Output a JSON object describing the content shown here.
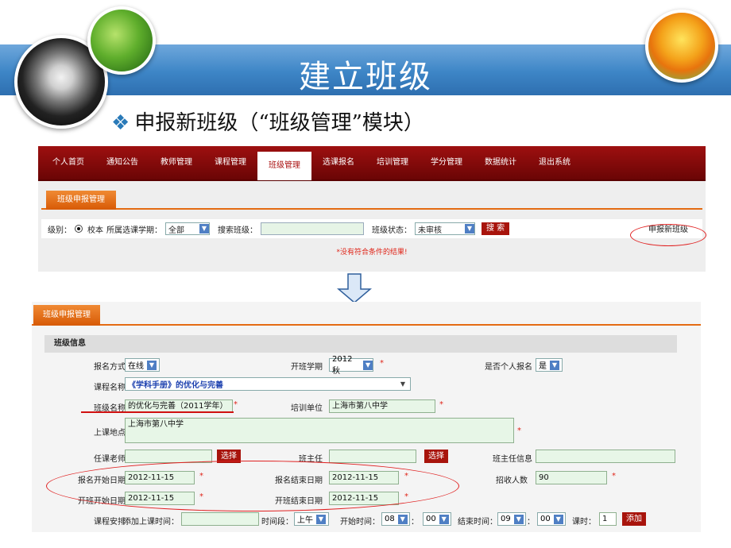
{
  "slide": {
    "title": "建立班级",
    "subtitle": "申报新班级（“班级管理”模块）"
  },
  "top_screen": {
    "nav": [
      "个人首页",
      "通知公告",
      "教师管理",
      "课程管理",
      "班级管理",
      "选课报名",
      "培训管理",
      "学分管理",
      "数据统计",
      "退出系统"
    ],
    "active_nav": "班级管理",
    "tab": "班级申报管理",
    "filter": {
      "level_label": "级别：",
      "level_option": "校本",
      "term_label": "所属选课学期：",
      "term_value": "全部",
      "search_label": "搜索班级：",
      "status_label": "班级状态：",
      "status_value": "未审核",
      "search_button": "搜 索",
      "apply_link": "申报新班级"
    },
    "no_result": "*没有符合条件的结果!"
  },
  "bottom_screen": {
    "tab": "班级申报管理",
    "section": "班级信息",
    "signup_mode_label": "报名方式",
    "signup_mode_value": "在线",
    "start_term_label": "开班学期",
    "start_term_value": "2012秋",
    "personal_signup_label": "是否个人报名",
    "personal_signup_value": "是",
    "course_label": "课程名称",
    "course_value": "《学科手册》的优化与完善",
    "class_name_label": "班级名称",
    "class_name_value": "的优化与完善（2011学年）",
    "training_unit_label": "培训单位",
    "training_unit_value": "上海市第八中学",
    "location_label": "上课地点",
    "location_value": "上海市第八中学",
    "teacher_label": "任课老师",
    "choose_button": "选择",
    "head_teacher_label": "班主任",
    "head_info_label": "班主任信息",
    "signup_start_label": "报名开始日期",
    "signup_start_value": "2012-11-15",
    "signup_end_label": "报名结束日期",
    "signup_end_value": "2012-11-15",
    "capacity_label": "招收人数",
    "capacity_value": "90",
    "class_start_label": "开班开始日期",
    "class_start_value": "2012-11-15",
    "class_end_label": "开班结束日期",
    "class_end_value": "2012-11-15",
    "schedule_label": "课程安排",
    "add_time_label": "添加上课时间：",
    "period_label": "时间段：",
    "period_value": "上午",
    "start_time_label": "开始时间：",
    "start_hour": "08",
    "start_min": "00",
    "end_time_label": "结束时间：",
    "end_hour": "09",
    "end_min": "00",
    "hours_label": "课时：",
    "hours_value": "1",
    "add_button": "添加",
    "colon": "：",
    "required_mark": "*"
  },
  "icons": {
    "bullet": "diamond-bullet-icon",
    "arrow": "down-arrow-icon",
    "dropdown": "chevron-down-icon"
  },
  "colors": {
    "banner": "#3d85c6",
    "nav": "#8a0b0b",
    "tab": "#e46b12",
    "required": "#e0261a",
    "annotation": "#e02020"
  }
}
